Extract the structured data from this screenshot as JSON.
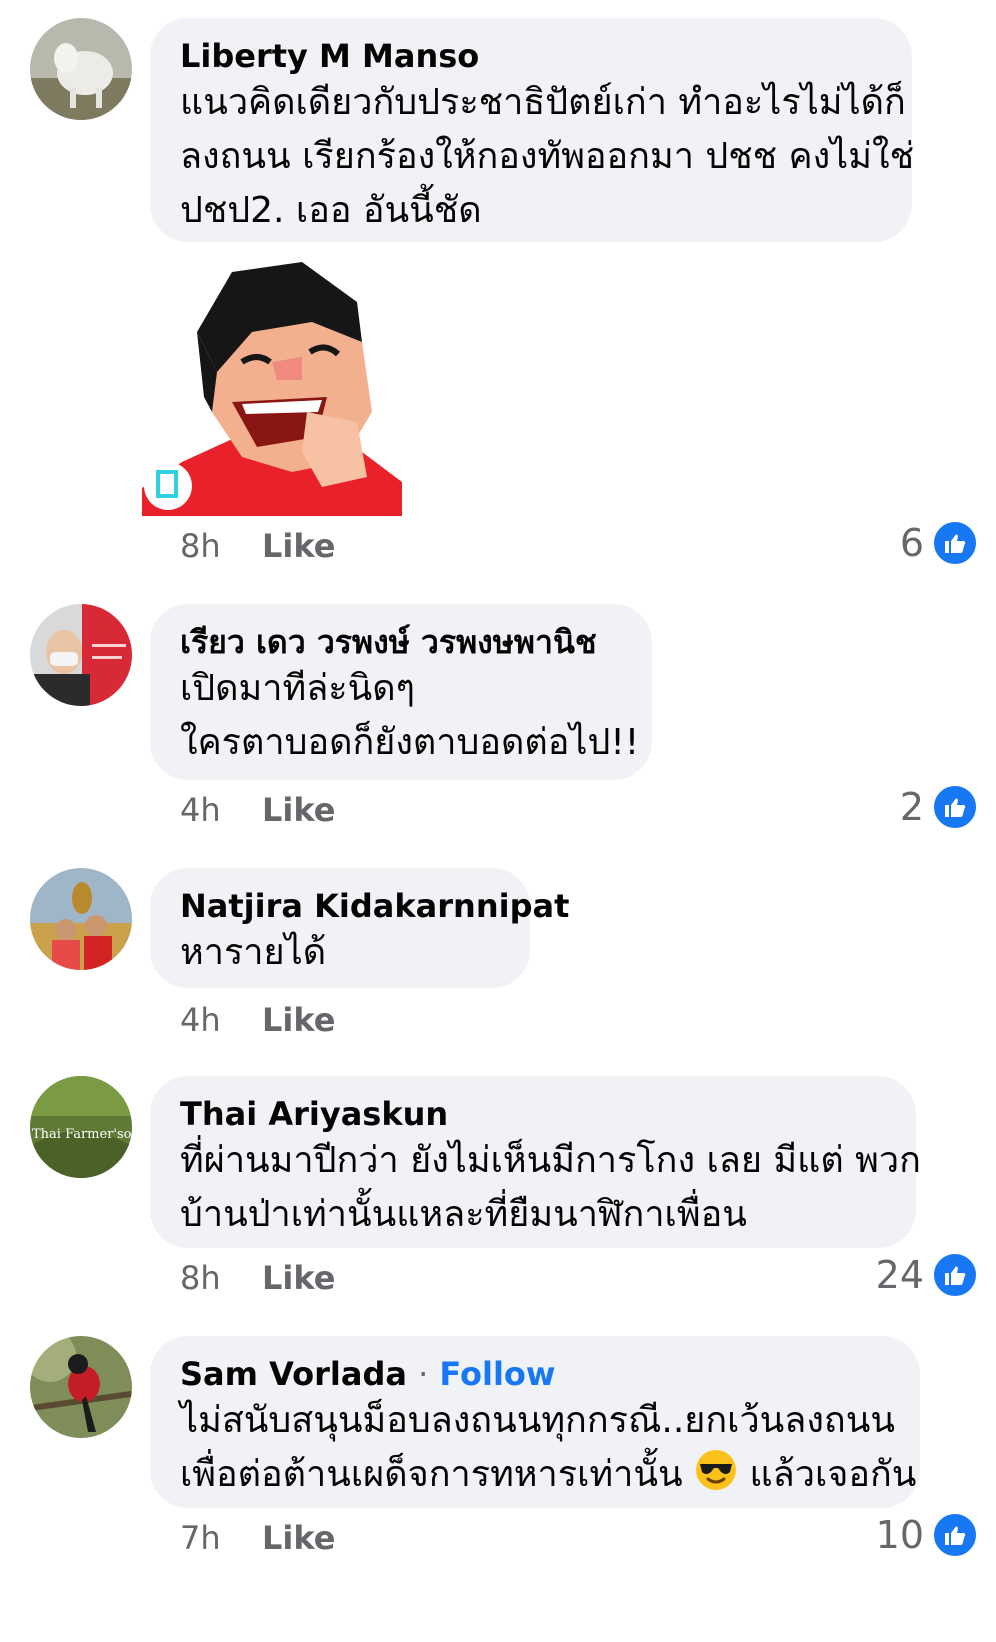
{
  "comments": [
    {
      "author": "Liberty M Manso",
      "lines": [
        "แนวคิดเดียวกับประชาธิปัตย์เก่า ทำอะไรไม่ได้ก็",
        "ลงถนน เรียกร้องให้กองทัพออกมา ปชช คงไม่ใช่",
        "ปชป2. เออ อันนี้ชัด"
      ],
      "time": "8h",
      "like_label": "Like",
      "reactions": "6"
    },
    {
      "author": "เรียว เดว วรพงษ์ วรพงษพานิช",
      "lines": [
        "เปิดมาทีล่ะนิดๆ",
        "ใครตาบอดก็ยังตาบอดต่อไป!!"
      ],
      "time": "4h",
      "like_label": "Like",
      "reactions": "2"
    },
    {
      "author": "Natjira Kidakarnnipat",
      "lines": [
        "หารายได้"
      ],
      "time": "4h",
      "like_label": "Like",
      "reactions": ""
    },
    {
      "author": "Thai Ariyaskun",
      "avatar_text": "Thai Farmer'son",
      "lines": [
        "ที่ผ่านมาปีกว่า ยังไม่เห็นมีการโกง เลย มีแต่ พวก",
        "บ้านป่าเท่านั้นแหละที่ยืมนาฬิกาเพื่อน"
      ],
      "time": "8h",
      "like_label": "Like",
      "reactions": "24"
    },
    {
      "author": "Sam Vorlada",
      "separator": "·",
      "follow_label": "Follow",
      "lines": [
        "ไม่สนับสนุนม็อบลงถนนทุกกรณี..ยกเว้นลงถนน",
        "เพื่อต่อต้านเผด็จการทหารเท่านั้น",
        "แล้วเจอกัน"
      ],
      "time": "7h",
      "like_label": "Like",
      "reactions": "10"
    }
  ],
  "icons": {
    "like_reaction": "thumbs-up-icon",
    "emoji": "sunglasses-emoji-icon",
    "sticker": "laughing-man-sticker"
  },
  "colors": {
    "accent": "#1877f2",
    "bubble": "#f0f2f5",
    "meta": "#65676b",
    "sticker_shirt": "#e8212a"
  }
}
